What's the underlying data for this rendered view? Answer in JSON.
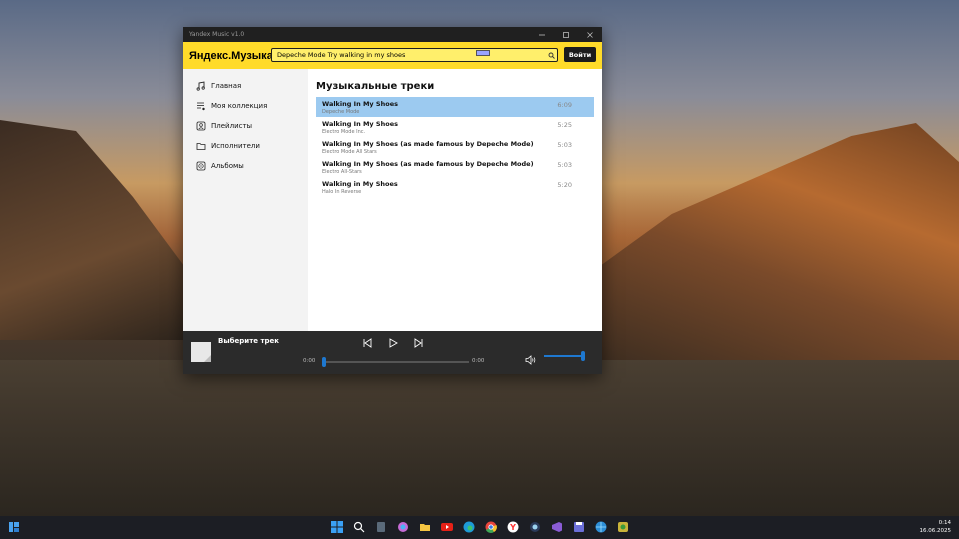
{
  "window": {
    "title": "Yandex Music v1.0"
  },
  "header": {
    "logo": "Яндекс.Музыка",
    "search_value": "Depeche Mode Try walking in my shoes",
    "login_label": "Войти"
  },
  "sidebar": {
    "items": [
      {
        "label": "Главная",
        "icon": "music-note-icon"
      },
      {
        "label": "Моя коллекция",
        "icon": "playlist-icon"
      },
      {
        "label": "Плейлисты",
        "icon": "user-square-icon"
      },
      {
        "label": "Исполнители",
        "icon": "folder-icon"
      },
      {
        "label": "Альбомы",
        "icon": "album-icon"
      }
    ]
  },
  "main": {
    "heading": "Музыкальные треки",
    "tracks": [
      {
        "title": "Walking In My Shoes",
        "artist": "Depeche Mode",
        "duration": "6:09",
        "selected": true
      },
      {
        "title": "Walking In My Shoes",
        "artist": "Electro Mode Inc.",
        "duration": "5:25"
      },
      {
        "title": "Walking In My Shoes (as made famous by Depeche Mode)",
        "artist": "Electro Mode All Stars",
        "duration": "5:03"
      },
      {
        "title": "Walking In My Shoes (as made famous by Depeche Mode)",
        "artist": "Electro All-Stars",
        "duration": "5:03"
      },
      {
        "title": "Walking in My Shoes",
        "artist": "Halo In Reverse",
        "duration": "5:20"
      }
    ]
  },
  "player": {
    "now_playing": "Выберите трек",
    "time_current": "0:00",
    "time_total": "0:00",
    "progress": 0,
    "volume": 1.0
  },
  "taskbar": {
    "time": "0:14",
    "date": "16.06.2025"
  },
  "colors": {
    "accent_yellow": "#ffdb2a",
    "selection": "#9ccaf0",
    "slider_blue": "#1e78d0",
    "player_bg": "#2b2b2b"
  }
}
